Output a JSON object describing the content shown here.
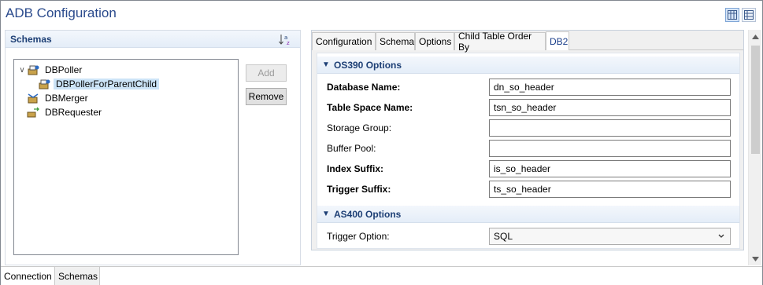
{
  "window": {
    "title": "ADB Configuration"
  },
  "toolbar": {
    "icons": [
      "columns-layout-icon",
      "list-layout-icon"
    ]
  },
  "schemas": {
    "header": "Schemas",
    "sort_icon": "sort-az-icon",
    "tree": [
      {
        "label": "DBPoller",
        "expanded": true,
        "icon": "poller-icon"
      },
      {
        "label": "DBPollerForParentChild",
        "selected": true,
        "icon": "poller-icon"
      },
      {
        "label": "DBMerger",
        "icon": "merger-icon"
      },
      {
        "label": "DBRequester",
        "icon": "requester-icon"
      }
    ],
    "add_label": "Add",
    "remove_label": "Remove"
  },
  "tabs": [
    "Configuration",
    "Schema",
    "Options",
    "Child Table Order By",
    "DB2"
  ],
  "active_tab": "DB2",
  "os390": {
    "title": "OS390 Options",
    "rows": [
      {
        "label": "Database Name:",
        "value": "dn_so_header",
        "bold": true
      },
      {
        "label": "Table Space Name:",
        "value": "tsn_so_header",
        "bold": true
      },
      {
        "label": "Storage Group:",
        "value": "",
        "bold": false
      },
      {
        "label": "Buffer Pool:",
        "value": "",
        "bold": false
      },
      {
        "label": "Index Suffix:",
        "value": "is_so_header",
        "bold": true
      },
      {
        "label": "Trigger Suffix:",
        "value": "ts_so_header",
        "bold": true
      }
    ]
  },
  "as400": {
    "title": "AS400 Options",
    "trigger_option_label": "Trigger Option:",
    "trigger_option_value": "SQL"
  },
  "bottom_tabs": [
    "Connection",
    "Schemas"
  ],
  "active_bottom_tab": "Schemas",
  "colors": {
    "title": "#2a4a8c",
    "section_text": "#1d3f75",
    "selection": "#cce4f7"
  }
}
